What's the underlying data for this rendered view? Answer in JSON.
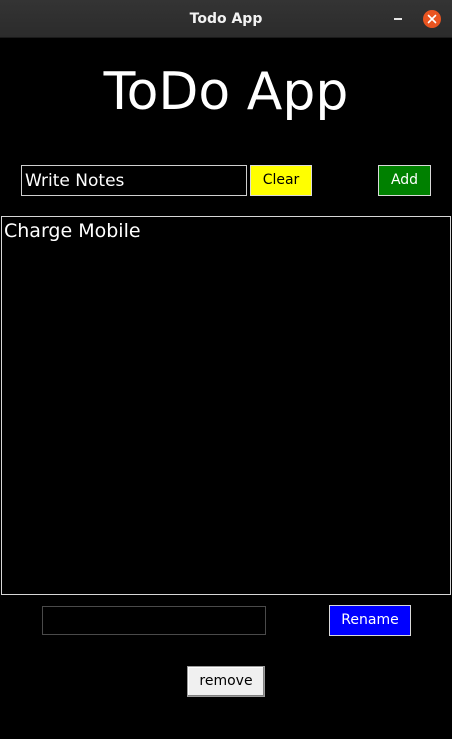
{
  "window": {
    "title": "Todo App",
    "close_color": "#e95420"
  },
  "heading": "ToDo App",
  "entry": {
    "value": "Write Notes",
    "placeholder": ""
  },
  "buttons": {
    "clear_label": "Clear",
    "clear_color": "#ffff00",
    "add_label": "Add",
    "add_color": "#008000",
    "rename_label": "Rename",
    "rename_color": "#0000ff",
    "remove_label": "remove"
  },
  "task_list": {
    "items": [
      "Charge Mobile"
    ]
  },
  "rename_entry": {
    "value": ""
  },
  "icons": {
    "minimize": "minimize-icon",
    "close": "close-icon"
  }
}
